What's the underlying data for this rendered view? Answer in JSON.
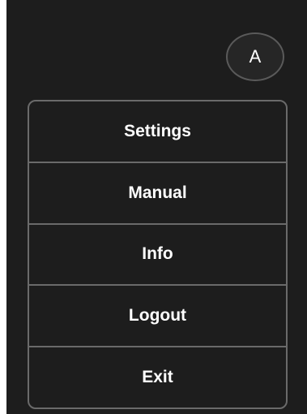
{
  "avatar": {
    "initial": "A"
  },
  "menu": {
    "items": [
      {
        "label": "Settings"
      },
      {
        "label": "Manual"
      },
      {
        "label": "Info"
      },
      {
        "label": "Logout"
      },
      {
        "label": "Exit"
      }
    ]
  },
  "colors": {
    "background": "#1d1d1d",
    "border": "#6a6a6a",
    "text": "#ffffff"
  }
}
